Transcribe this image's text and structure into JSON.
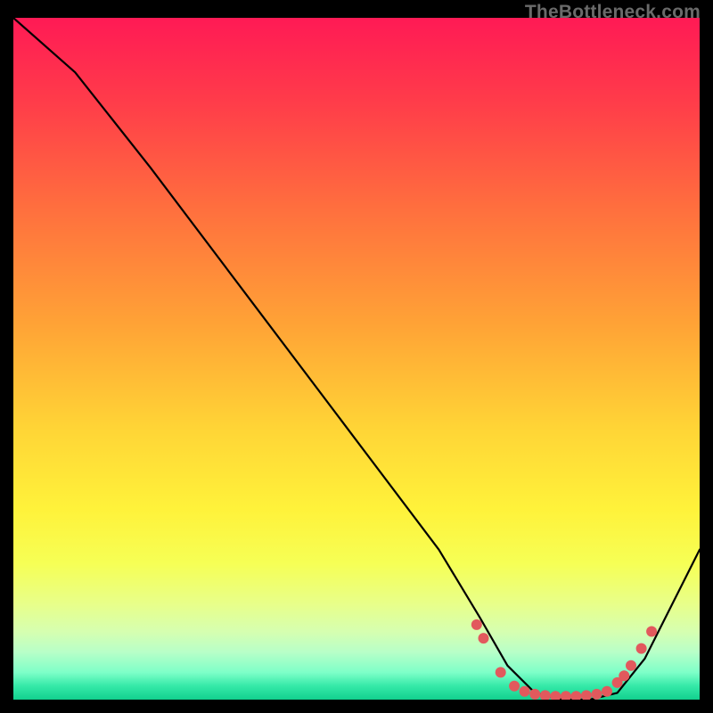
{
  "watermark": "TheBottleneck.com",
  "chart_data": {
    "type": "line",
    "title": "",
    "xlabel": "",
    "ylabel": "",
    "xlim": [
      0,
      100
    ],
    "ylim": [
      0,
      100
    ],
    "gradient_stops": [
      {
        "offset": 0,
        "color": "#ff1a55"
      },
      {
        "offset": 12,
        "color": "#ff3b4a"
      },
      {
        "offset": 28,
        "color": "#ff6f3e"
      },
      {
        "offset": 45,
        "color": "#ffa336"
      },
      {
        "offset": 60,
        "color": "#ffd436"
      },
      {
        "offset": 72,
        "color": "#fff23a"
      },
      {
        "offset": 80,
        "color": "#f6ff55"
      },
      {
        "offset": 86,
        "color": "#e8ff8a"
      },
      {
        "offset": 90,
        "color": "#d6ffb0"
      },
      {
        "offset": 93,
        "color": "#b8ffc8"
      },
      {
        "offset": 96,
        "color": "#7effc8"
      },
      {
        "offset": 98,
        "color": "#35e9a8"
      },
      {
        "offset": 100,
        "color": "#12d08e"
      }
    ],
    "series": [
      {
        "name": "bottleneck-curve",
        "x": [
          0,
          9,
          20,
          35,
          50,
          62,
          68,
          72,
          76,
          80,
          84,
          88,
          92,
          100
        ],
        "y": [
          100,
          92,
          78,
          58,
          38,
          22,
          12,
          5,
          1,
          0,
          0,
          1,
          6,
          22
        ]
      }
    ],
    "markers": {
      "name": "optimal-band-dots",
      "color": "#e2595d",
      "x": [
        67.5,
        68.5,
        71,
        73,
        74.5,
        76,
        77.5,
        79,
        80.5,
        82,
        83.5,
        85,
        86.5,
        88,
        89,
        90,
        91.5,
        93
      ],
      "y": [
        11,
        9,
        4,
        2,
        1.2,
        0.8,
        0.6,
        0.5,
        0.5,
        0.5,
        0.6,
        0.8,
        1.2,
        2.5,
        3.5,
        5,
        7.5,
        10
      ]
    }
  }
}
